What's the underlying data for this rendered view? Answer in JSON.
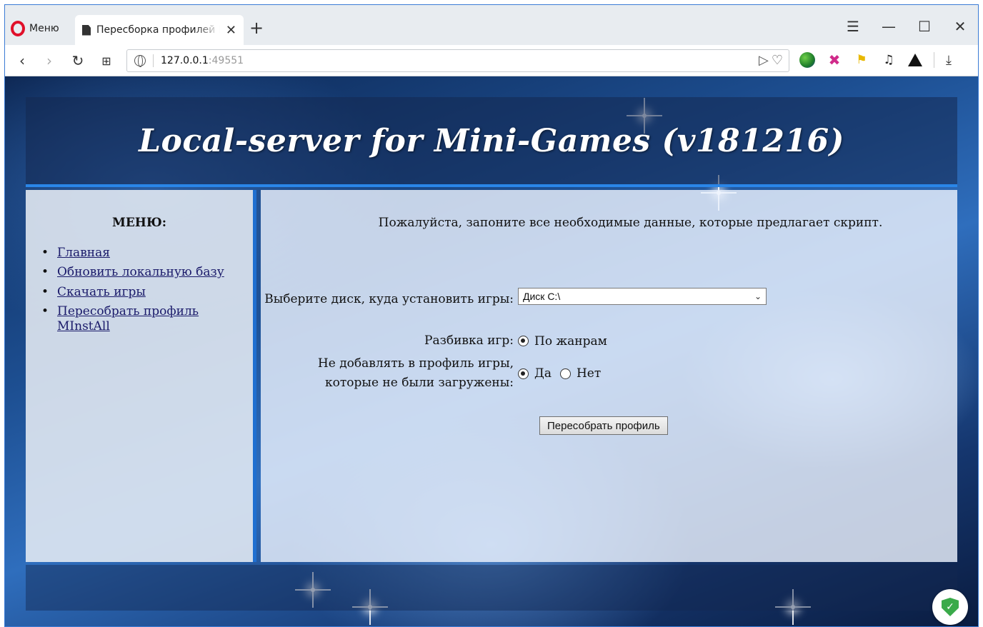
{
  "browser": {
    "menu_label": "Меню",
    "tab_title": "Пересборка профилей Mini",
    "new_tab": "+",
    "url_host": "127.0.0.1",
    "url_port": ":49551",
    "accent": "#3a7bd5"
  },
  "site": {
    "title": "Local-server for Mini-Games (v181216)"
  },
  "sidebar": {
    "heading": "МЕНЮ:",
    "items": [
      {
        "label": "Главная"
      },
      {
        "label": "Обновить локальную базу"
      },
      {
        "label": "Скачать игры"
      },
      {
        "label": "Пересобрать профиль MInstAll"
      }
    ]
  },
  "main": {
    "intro": "Пожалуйста, запоните все необходимые данные, которые предлагает скрипт.",
    "disk_label": "Выберите диск, куда установить игры:",
    "disk_value": "Диск C:\\",
    "split_label": "Разбивка игр:",
    "split_option": "По жанрам",
    "skip_label": "Не добавлять в профиль игры, которые не были загружены:",
    "skip_yes": "Да",
    "skip_no": "Нет",
    "submit_label": "Пересобрать профиль"
  }
}
